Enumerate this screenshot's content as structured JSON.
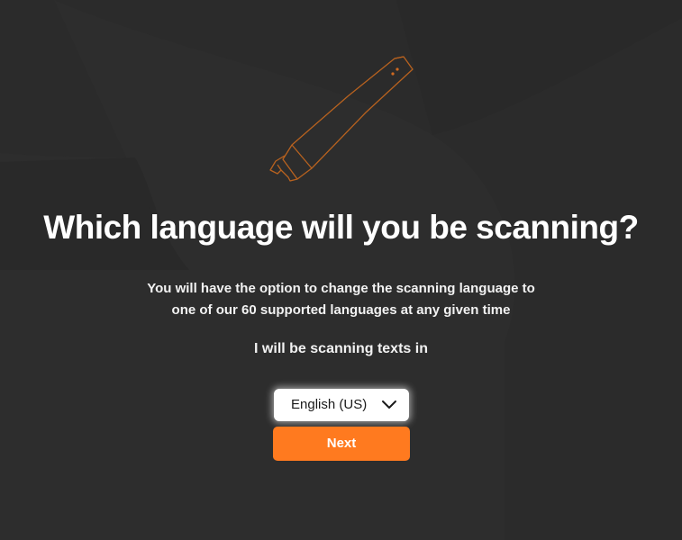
{
  "page": {
    "title": "Which language will you be scanning?",
    "subtitle_line1": "You will have the option to change the scanning language to",
    "subtitle_line2": "one of our 60 supported languages at any given time",
    "scan_label": "I will be scanning texts in"
  },
  "language_select": {
    "selected": "English (US)",
    "icon": "chevron-down-icon"
  },
  "next_button": {
    "label": "Next"
  },
  "illustration": {
    "icon": "scanner-pen-icon"
  },
  "colors": {
    "background": "#2b2b2b",
    "accent": "#ff7a1f",
    "text": "#ffffff"
  }
}
